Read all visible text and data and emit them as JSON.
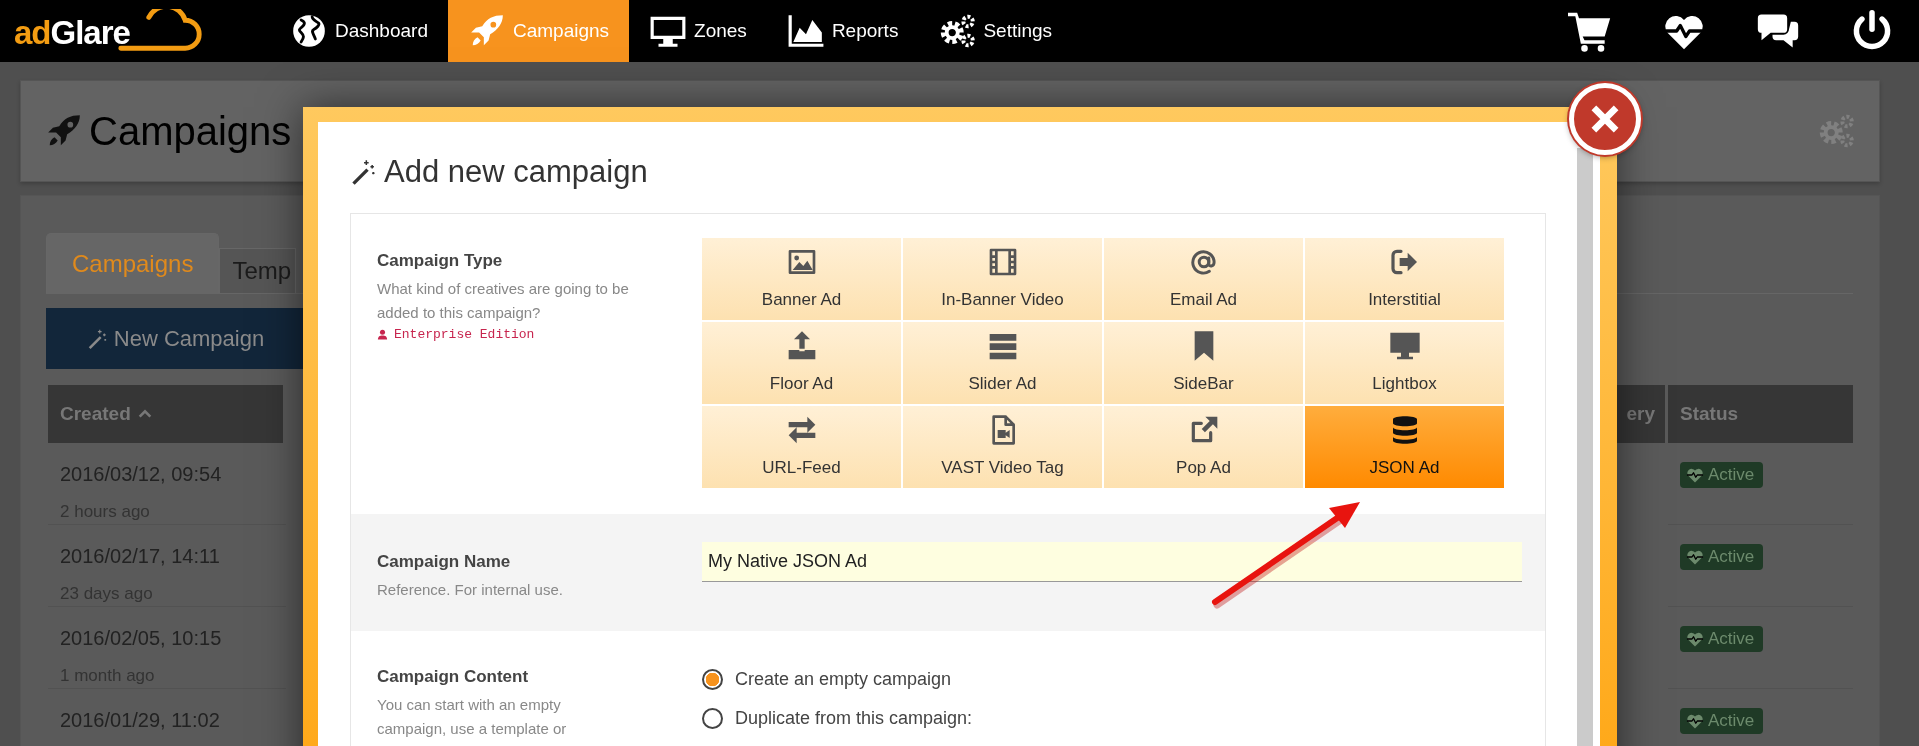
{
  "nav": {
    "logo": {
      "prefix": "ad",
      "name": "Glare"
    },
    "items": [
      {
        "label": "Dashboard",
        "selected": false
      },
      {
        "label": "Campaigns",
        "selected": true
      },
      {
        "label": "Zones",
        "selected": false
      },
      {
        "label": "Reports",
        "selected": false
      },
      {
        "label": "Settings",
        "selected": false
      }
    ]
  },
  "page": {
    "title": "Campaigns",
    "tabs": [
      {
        "label": "Campaigns",
        "selected": true
      },
      {
        "label": "Temp",
        "selected": false
      }
    ],
    "new_button": "New Campaign",
    "table": {
      "columns": [
        "Created",
        "ery",
        "Status"
      ],
      "rows": [
        {
          "created": "2016/03/12, 09:54",
          "age": "2 hours ago",
          "status": "Active"
        },
        {
          "created": "2016/02/17, 14:11",
          "age": "23 days ago",
          "status": "Active"
        },
        {
          "created": "2016/02/05, 10:15",
          "age": "1 month ago",
          "status": "Active"
        },
        {
          "created": "2016/01/29, 11:02",
          "status": "Active"
        }
      ]
    }
  },
  "dialog": {
    "title": "Add new campaign",
    "campaign_type": {
      "label": "Campaign Type",
      "hint": "What kind of creatives are going to be added to this campaign?",
      "edition": "Enterprise Edition",
      "options": [
        {
          "label": "Banner Ad",
          "selected": false
        },
        {
          "label": "In-Banner Video",
          "selected": false
        },
        {
          "label": "Email Ad",
          "selected": false
        },
        {
          "label": "Interstitial",
          "selected": false
        },
        {
          "label": "Floor Ad",
          "selected": false
        },
        {
          "label": "Slider Ad",
          "selected": false
        },
        {
          "label": "SideBar",
          "selected": false
        },
        {
          "label": "Lightbox",
          "selected": false
        },
        {
          "label": "URL-Feed",
          "selected": false
        },
        {
          "label": "VAST Video Tag",
          "selected": false
        },
        {
          "label": "Pop Ad",
          "selected": false
        },
        {
          "label": "JSON Ad",
          "selected": true
        }
      ]
    },
    "campaign_name": {
      "label": "Campaign Name",
      "hint": "Reference. For internal use.",
      "value": "My Native JSON Ad"
    },
    "campaign_content": {
      "label": "Campaign Content",
      "hint": "You can start with an empty campaign, use a template or",
      "options": [
        {
          "label": "Create an empty campaign",
          "selected": true
        },
        {
          "label": "Duplicate from this campaign:",
          "selected": false
        }
      ]
    }
  }
}
